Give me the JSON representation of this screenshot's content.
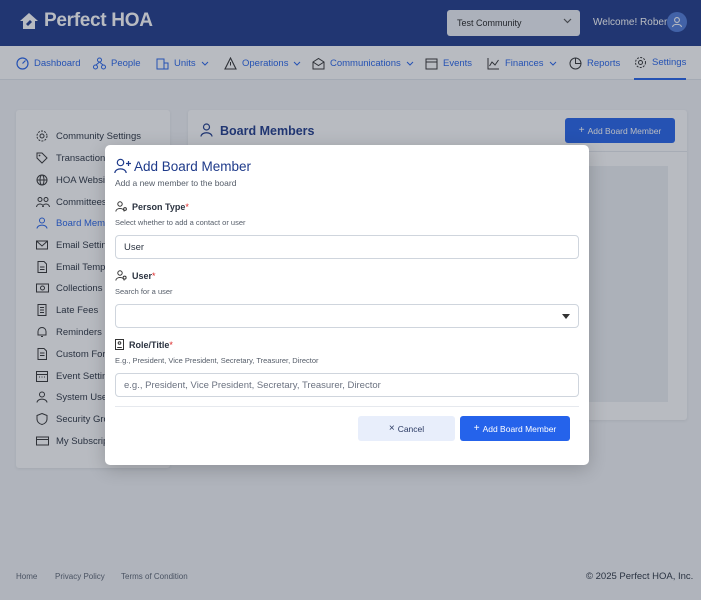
{
  "brand": {
    "name": "Perfect HOA"
  },
  "header": {
    "community_select": "Test Community",
    "welcome": "Welcome! Robert"
  },
  "nav": {
    "items": [
      {
        "label": "Dashboard",
        "icon": "gauge-icon"
      },
      {
        "label": "People",
        "icon": "people-network-icon"
      },
      {
        "label": "Units",
        "icon": "building-icon"
      },
      {
        "label": "Operations",
        "icon": "warning-triangle-icon"
      },
      {
        "label": "Communications",
        "icon": "envelope-open-icon"
      },
      {
        "label": "Events",
        "icon": "calendar-icon"
      },
      {
        "label": "Finances",
        "icon": "chart-line-icon"
      },
      {
        "label": "Reports",
        "icon": "pie-chart-icon"
      },
      {
        "label": "Settings",
        "icon": "gear-icon"
      }
    ],
    "active": "Settings"
  },
  "sidebar": {
    "items": [
      {
        "label": "Community Settings",
        "icon": "gear-icon"
      },
      {
        "label": "Transaction",
        "icon": "tag-icon"
      },
      {
        "label": "HOA Website",
        "icon": "globe-icon"
      },
      {
        "label": "Committees",
        "icon": "people-icon"
      },
      {
        "label": "Board Members",
        "icon": "user-icon"
      },
      {
        "label": "Email Settings",
        "icon": "envelope-icon"
      },
      {
        "label": "Email Templates",
        "icon": "document-icon"
      },
      {
        "label": "Collections",
        "icon": "money-icon"
      },
      {
        "label": "Late Fees",
        "icon": "receipt-icon"
      },
      {
        "label": "Reminders",
        "icon": "bell-icon"
      },
      {
        "label": "Custom Forms",
        "icon": "form-icon"
      },
      {
        "label": "Event Settings",
        "icon": "calendar-icon"
      },
      {
        "label": "System Users",
        "icon": "user-icon"
      },
      {
        "label": "Security Groups",
        "icon": "shield-icon"
      },
      {
        "label": "My Subscription",
        "icon": "card-icon"
      }
    ],
    "active": "Board Members"
  },
  "main": {
    "title": "Board Members",
    "add_button": "Add Board Member"
  },
  "footer": {
    "links": [
      "Home",
      "Privacy Policy",
      "Terms of Condition"
    ],
    "copyright": "© 2025 Perfect HOA, Inc."
  },
  "modal": {
    "title": "Add Board Member",
    "subtitle": "Add a new member to the board",
    "person_type": {
      "label": "Person Type",
      "required_mark": "*",
      "help": "Select whether to add a contact or user",
      "value": "User"
    },
    "user": {
      "label": "User",
      "required_mark": "*",
      "help": "Search for a user",
      "value": ""
    },
    "role": {
      "label": "Role/Title",
      "required_mark": "*",
      "help": "E.g., President, Vice President, Secretary, Treasurer, Director",
      "placeholder": "e.g., President, Vice President, Secretary, Treasurer, Director"
    },
    "cancel_label": "Cancel",
    "confirm_label": "Add Board Member"
  },
  "colors": {
    "brand_dark": "#1e3a8a",
    "accent": "#2563eb",
    "required": "#dc2626"
  }
}
